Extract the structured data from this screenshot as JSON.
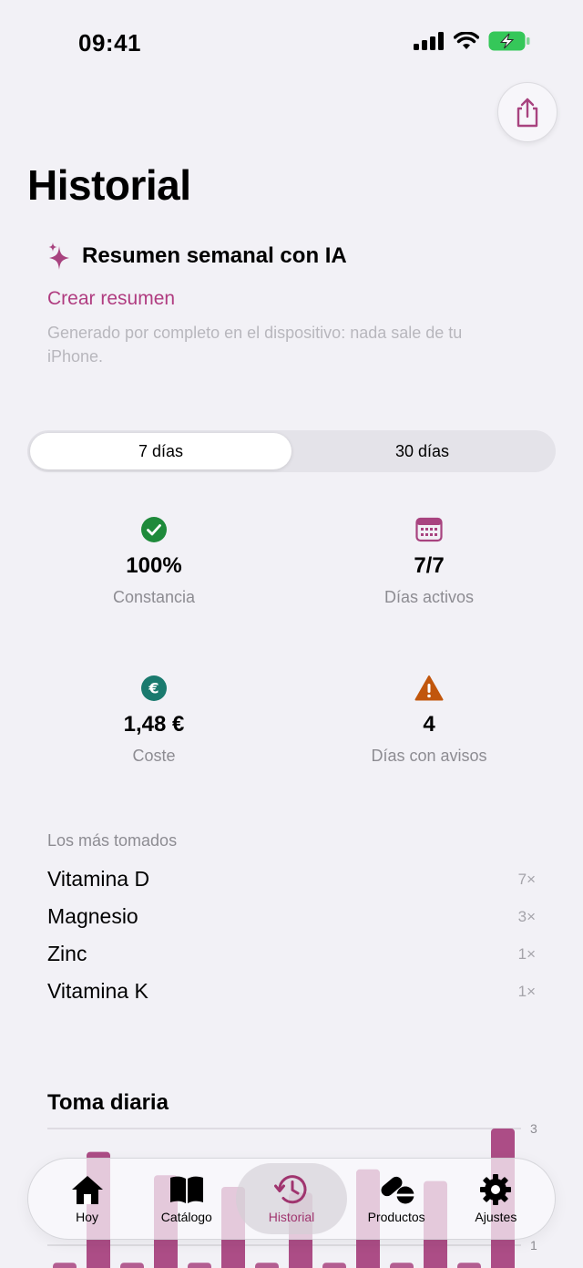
{
  "status_bar": {
    "time": "09:41"
  },
  "page": {
    "title": "Historial"
  },
  "ai_summary": {
    "title": "Resumen semanal con IA",
    "link": "Crear resumen",
    "note": "Generado por completo en el dispositivo: nada sale de tu iPhone."
  },
  "period_selector": {
    "options": [
      "7 días",
      "30 días"
    ],
    "selected": "7 días"
  },
  "stats": [
    {
      "value": "100%",
      "label": "Constancia",
      "icon": "checkmark-circle-icon",
      "color": "#1f8a3b"
    },
    {
      "value": "7/7",
      "label": "Días activos",
      "icon": "calendar-icon",
      "color": "#a8437f"
    },
    {
      "value": "1,48 €",
      "label": "Coste",
      "icon": "euro-circle-icon",
      "color": "#1a7a6e"
    },
    {
      "value": "4",
      "label": "Días con avisos",
      "icon": "warning-triangle-icon",
      "color": "#c1560c"
    }
  ],
  "most_taken": {
    "header": "Los más tomados",
    "items": [
      {
        "name": "Vitamina D",
        "count": "7×"
      },
      {
        "name": "Magnesio",
        "count": "3×"
      },
      {
        "name": "Zinc",
        "count": "1×"
      },
      {
        "name": "Vitamina K",
        "count": "1×"
      }
    ]
  },
  "daily_intake": {
    "title": "Toma diaria",
    "chart_data": {
      "type": "bar",
      "title": "Toma diaria",
      "y_tick_labels": [
        "3",
        "1"
      ],
      "ylim": [
        0,
        3
      ],
      "values": [
        0.7,
        2.6,
        0.7,
        2.2,
        0.7,
        2.0,
        0.7,
        1.9,
        0.7,
        2.3,
        0.7,
        2.1,
        0.7,
        3.0
      ],
      "bar_color": "#a8437f",
      "grid": true
    }
  },
  "tab_bar": {
    "items": [
      {
        "label": "Hoy",
        "icon": "house-icon"
      },
      {
        "label": "Catálogo",
        "icon": "book-icon"
      },
      {
        "label": "Historial",
        "icon": "clock-history-icon"
      },
      {
        "label": "Productos",
        "icon": "pills-icon"
      },
      {
        "label": "Ajustes",
        "icon": "gear-icon"
      }
    ],
    "selected": "Historial"
  }
}
